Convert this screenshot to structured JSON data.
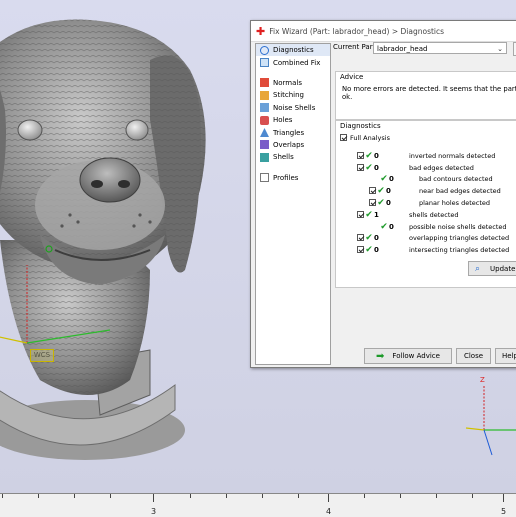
{
  "dialog": {
    "title": "Fix Wizard (Part: labrador_head) > Diagnostics",
    "current_part_label": "Current Part:",
    "current_part_value": "labrador_head",
    "nav": [
      {
        "label": "Diagnostics",
        "icon": "diagnostics-icon"
      },
      {
        "label": "Combined Fix",
        "icon": "combined-fix-icon"
      },
      {
        "label": "Normals",
        "icon": "normals-icon"
      },
      {
        "label": "Stitching",
        "icon": "stitching-icon"
      },
      {
        "label": "Noise Shells",
        "icon": "noise-shells-icon"
      },
      {
        "label": "Holes",
        "icon": "holes-icon"
      },
      {
        "label": "Triangles",
        "icon": "triangles-icon"
      },
      {
        "label": "Overlaps",
        "icon": "overlaps-icon"
      },
      {
        "label": "Shells",
        "icon": "shells-icon"
      },
      {
        "label": "Profiles",
        "icon": "profiles-icon"
      }
    ],
    "advice": {
      "title": "Advice",
      "text": "No more errors are detected. It seems that the part is ok."
    },
    "diagnostics": {
      "title": "Diagnostics",
      "full_analysis_label": "Full Analysis",
      "rows": [
        {
          "count": "0",
          "label": "inverted normals detected",
          "has_checkbox": true
        },
        {
          "count": "0",
          "label": "bad edges detected",
          "has_checkbox": true
        },
        {
          "count": "0",
          "label": "bad contours detected",
          "has_checkbox": false
        },
        {
          "count": "0",
          "label": "near bad edges detected",
          "has_checkbox": true
        },
        {
          "count": "0",
          "label": "planar holes detected",
          "has_checkbox": true
        },
        {
          "count": "1",
          "label": "shells detected",
          "has_checkbox": true
        },
        {
          "count": "0",
          "label": "possible noise shells detected",
          "has_checkbox": false
        },
        {
          "count": "0",
          "label": "overlapping triangles detected",
          "has_checkbox": true
        },
        {
          "count": "0",
          "label": "intersecting triangles detected",
          "has_checkbox": true
        }
      ],
      "update_label": "Update"
    },
    "buttons": {
      "follow_advice": "Follow Advice",
      "close": "Close",
      "help": "Help"
    }
  },
  "viewport": {
    "wcs_label": "WCS",
    "axis_z_label": "Z"
  },
  "ruler": {
    "labels": [
      "3",
      "4",
      "5"
    ]
  },
  "colors": {
    "accent_check": "#1d9a2a",
    "title_plus": "#e02020",
    "axis_x": "#2dbb2d",
    "axis_y": "#d0c000",
    "axis_z": "#d22222"
  }
}
